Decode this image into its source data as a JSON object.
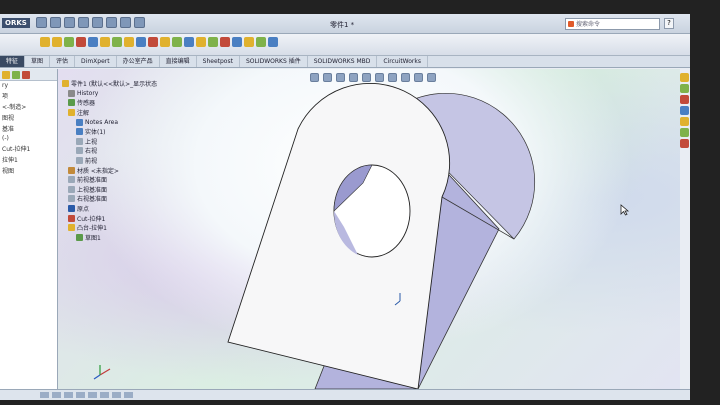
{
  "app": {
    "brand": "ORKS",
    "window_title": "零件1 *"
  },
  "search": {
    "placeholder": "搜索命令"
  },
  "tabs": [
    "特征",
    "草图",
    "评估",
    "DimXpert",
    "办公室产品",
    "直接编辑",
    "Sheetpost",
    "SOLIDWORKS 插件",
    "SOLIDWORKS MBD",
    "CircuitWorks"
  ],
  "left_panel": {
    "items": [
      "ry",
      "项",
      "<-制造>",
      "图视",
      "基准",
      "(-)",
      "Cut-拉伸1",
      "拉伸1",
      "视图"
    ]
  },
  "feature_tree": {
    "header": "零件1 (默认<<默认>_显示状态",
    "rows": [
      {
        "label": "History",
        "icon": "history-icon"
      },
      {
        "label": "传感器",
        "icon": "sensor-icon"
      },
      {
        "label": "注解",
        "icon": "annotation-icon"
      },
      {
        "label": "Notes Area",
        "icon": "notes-icon"
      },
      {
        "label": "实体(1)",
        "icon": "solid-body-icon"
      },
      {
        "label": "上视",
        "icon": "plane-icon"
      },
      {
        "label": "右视",
        "icon": "plane-icon"
      },
      {
        "label": "前视",
        "icon": "plane-icon"
      },
      {
        "label": "材质 <未指定>",
        "icon": "material-icon"
      },
      {
        "label": "前视基准面",
        "icon": "plane-icon"
      },
      {
        "label": "上视基准面",
        "icon": "plane-icon"
      },
      {
        "label": "右视基准面",
        "icon": "plane-icon"
      },
      {
        "label": "原点",
        "icon": "origin-icon"
      },
      {
        "label": "Cut-拉伸1",
        "icon": "cut-extrude-icon"
      },
      {
        "label": "凸台-拉伸1",
        "icon": "boss-extrude-icon"
      },
      {
        "label": "草图1",
        "icon": "sketch-icon"
      }
    ]
  },
  "colors": {
    "accent": "#3a4a63",
    "face_side": "#b3b3dd",
    "face_top": "#f7f7f8"
  }
}
